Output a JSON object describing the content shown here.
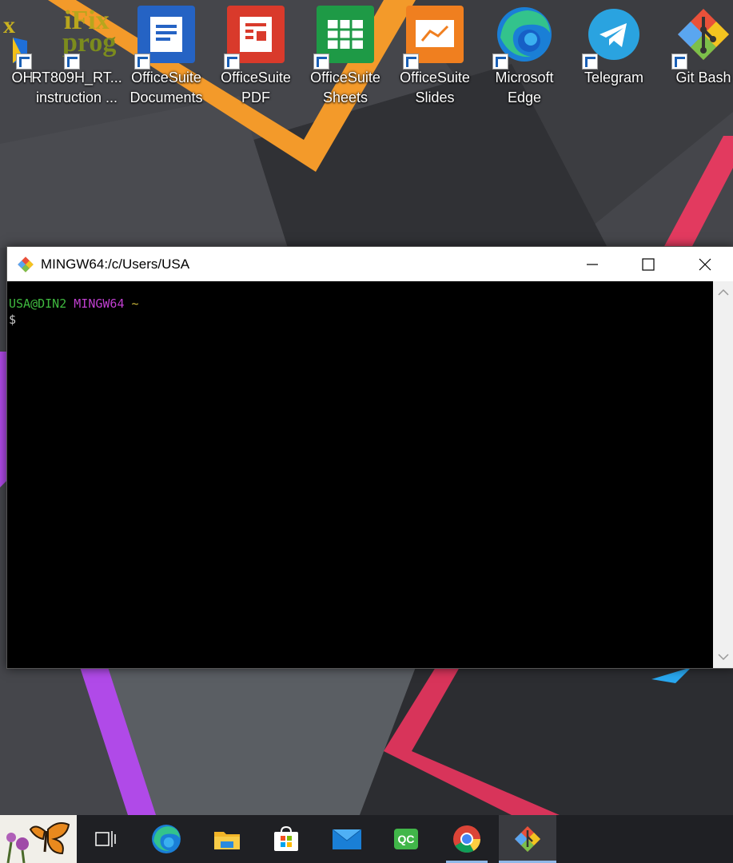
{
  "desktop": {
    "icons": [
      {
        "label": "OH"
      },
      {
        "label": "RT809H_RT...\ninstruction ...",
        "logo_line1": "iFix",
        "logo_line2": "prog"
      },
      {
        "label": "OfficeSuite\nDocuments"
      },
      {
        "label": "OfficeSuite\nPDF"
      },
      {
        "label": "OfficeSuite\nSheets"
      },
      {
        "label": "OfficeSuite\nSlides"
      },
      {
        "label": "Microsoft\nEdge"
      },
      {
        "label": "Telegram"
      },
      {
        "label": "Git Bash"
      }
    ]
  },
  "terminal": {
    "title": "MINGW64:/c/Users/USA",
    "prompt_user": "USA@DIN2",
    "prompt_env": "MINGW64",
    "prompt_path": "~",
    "prompt_symbol": "$",
    "colors": {
      "user": "#3fb93f",
      "env": "#c03fd0",
      "path": "#c8b43a",
      "symbol": "#cccccc"
    }
  },
  "taskbar": {
    "items": [
      {
        "icon": "butterfly-widget-icon"
      },
      {
        "icon": "task-view-icon"
      },
      {
        "icon": "edge-icon"
      },
      {
        "icon": "file-explorer-icon"
      },
      {
        "icon": "microsoft-store-icon"
      },
      {
        "icon": "mail-icon"
      },
      {
        "icon": "qc-app-icon",
        "label": "QC"
      },
      {
        "icon": "chrome-icon"
      },
      {
        "icon": "git-bash-icon",
        "active": true
      }
    ]
  }
}
